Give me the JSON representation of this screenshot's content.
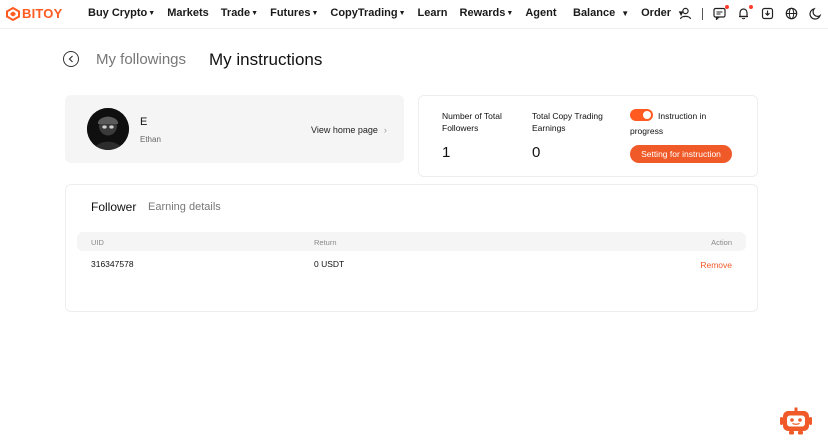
{
  "brand": {
    "name": "BITOY",
    "accent": "#ff5a1f"
  },
  "nav": {
    "items": [
      {
        "label": "Buy Crypto",
        "caret": true
      },
      {
        "label": "Markets",
        "caret": false
      },
      {
        "label": "Trade",
        "caret": true
      },
      {
        "label": "Futures",
        "caret": true
      },
      {
        "label": "CopyTrading",
        "caret": true
      },
      {
        "label": "Learn",
        "caret": false
      },
      {
        "label": "Rewards",
        "caret": true
      },
      {
        "label": "Agent",
        "caret": false
      }
    ],
    "balance_label": "Balance",
    "order_label": "Order",
    "icons": [
      "user-icon",
      "message-icon",
      "bell-icon",
      "download-icon",
      "globe-icon",
      "moon-icon"
    ]
  },
  "page": {
    "tab_followings": "My followings",
    "tab_instructions": "My instructions"
  },
  "profile": {
    "name": "E",
    "subname": "Ethan",
    "view_home": "View home page"
  },
  "stats": {
    "followers_label": "Number of Total Followers",
    "followers_value": "1",
    "earnings_label": "Total Copy Trading Earnings",
    "earnings_value": "0",
    "instruction_label": "Instruction in progress",
    "instruction_on": true,
    "setting_button": "Setting for instruction"
  },
  "table": {
    "tabs": {
      "follower": "Follower",
      "earning": "Earning details"
    },
    "headers": {
      "uid": "UID",
      "return": "Return",
      "action": "Action"
    },
    "rows": [
      {
        "uid": "316347578",
        "return": "0 USDT",
        "action": "Remove"
      }
    ]
  }
}
